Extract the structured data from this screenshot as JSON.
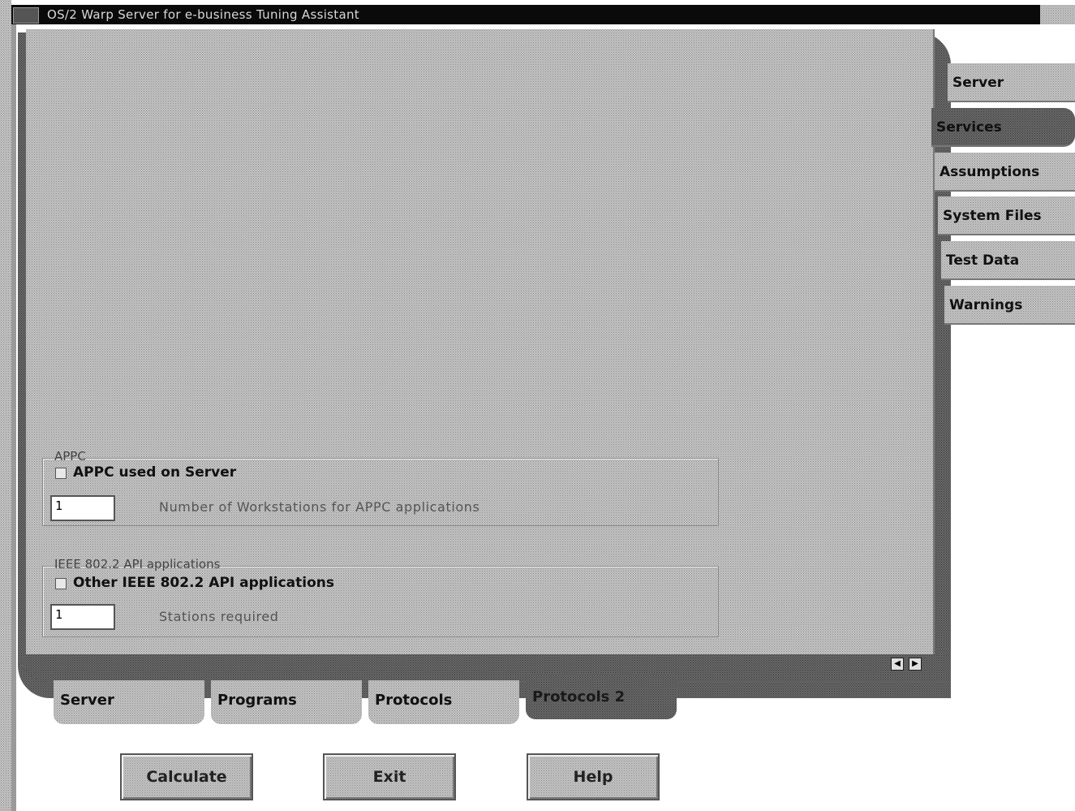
{
  "window": {
    "title": "OS/2 Warp Server for e-business Tuning Assistant"
  },
  "right_tabs": [
    {
      "label": "Server",
      "active": false
    },
    {
      "label": "Services",
      "active": true
    },
    {
      "label": "Assumptions",
      "active": false
    },
    {
      "label": "System Files",
      "active": false
    },
    {
      "label": "Test Data",
      "active": false
    },
    {
      "label": "Warnings",
      "active": false
    }
  ],
  "bottom_tabs": [
    {
      "label": "Server",
      "active": false
    },
    {
      "label": "Programs",
      "active": false
    },
    {
      "label": "Protocols",
      "active": false
    },
    {
      "label": "Protocols 2",
      "active": true
    }
  ],
  "groups": {
    "appc": {
      "title": "APPC",
      "checkbox_label": "APPC used on Server",
      "checked": false,
      "field_value": "1",
      "field_label": "Number of Workstations for APPC applications"
    },
    "ieee": {
      "title": "IEEE 802.2 API applications",
      "checkbox_label": "Other IEEE 802.2 API applications",
      "checked": false,
      "field_value": "1",
      "field_label": "Stations required"
    }
  },
  "scroll": {
    "left_icon": "arrow-left-icon",
    "right_icon": "arrow-right-icon"
  },
  "buttons": {
    "calculate": "Calculate",
    "exit": "Exit",
    "help": "Help"
  }
}
